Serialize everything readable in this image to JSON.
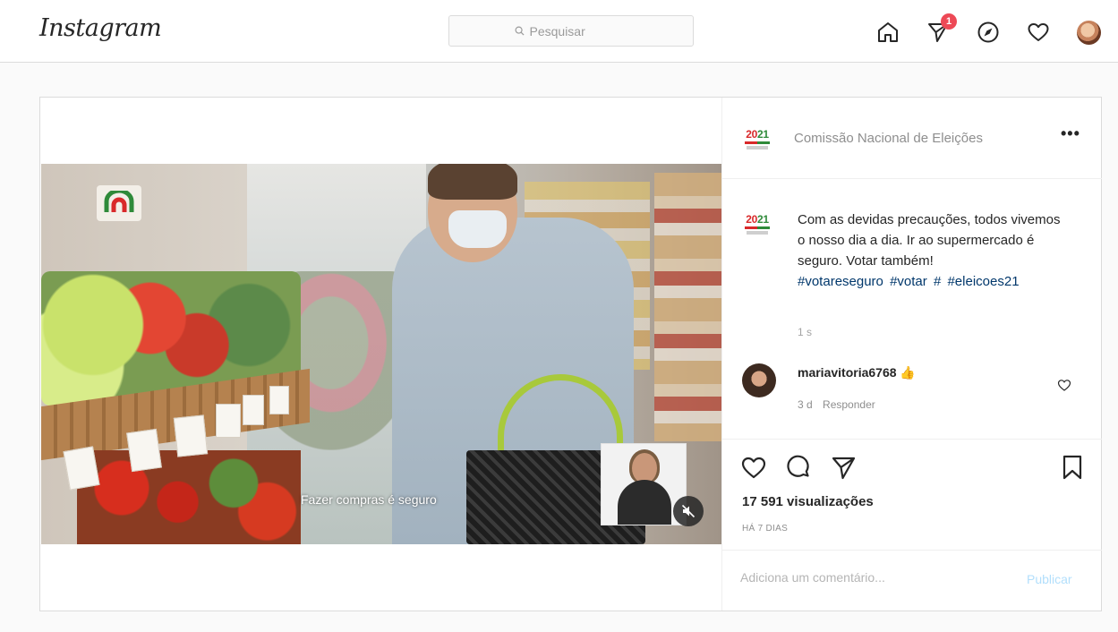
{
  "topbar": {
    "logo": "Instagram",
    "search": {
      "placeholder": "Pesquisar"
    },
    "icons": [
      "home-icon",
      "direct-messages-icon",
      "explore-icon",
      "activity-heart-icon",
      "profile-avatar"
    ],
    "direct_badge": "1"
  },
  "post": {
    "account": "Comissão Nacional de Eleições",
    "more_label": "•••",
    "video": {
      "caption_overlay": "Fazer compras é seguro",
      "muted": true
    },
    "caption": {
      "text": "Com as devidas precauções, todos vivemos o nosso dia a dia. Ir ao supermercado é seguro. Votar também!",
      "hashtags": [
        "#votareseguro",
        "#votar",
        "#",
        "#eleicoes21"
      ],
      "time": "1 s"
    },
    "comment": {
      "user": "mariavitoria6768",
      "emoji": "👍",
      "time": "3 d",
      "reply_label": "Responder"
    },
    "views": "17 591 visualizações",
    "posted_ago": "HÁ 7 DIAS",
    "add_comment": {
      "placeholder": "Adiciona um comentário...",
      "publish_label": "Publicar"
    }
  },
  "colors": {
    "link": "#00376b",
    "badge": "#ed4956",
    "publish_disabled": "#b2dffc",
    "cne_red": "#d9292a",
    "cne_green": "#2f8a3a"
  }
}
